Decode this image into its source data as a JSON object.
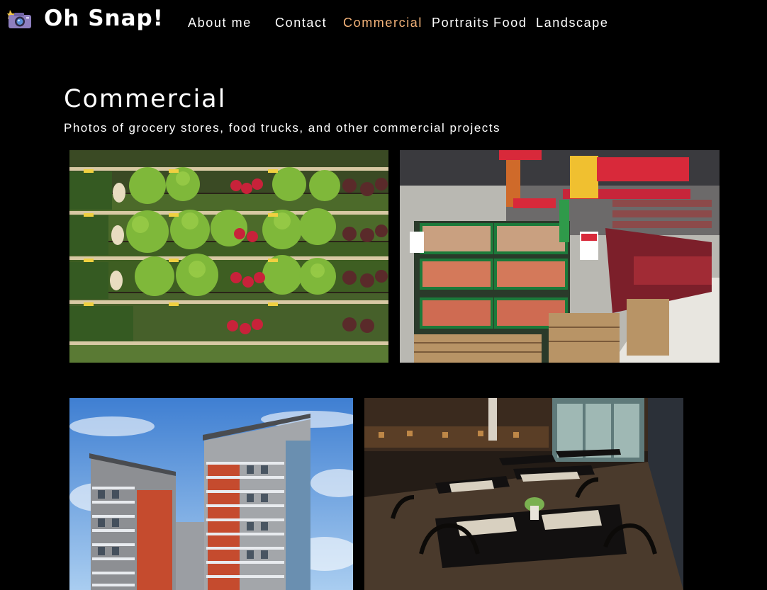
{
  "site": {
    "name": "Oh Snap!",
    "logo_icon": "camera-icon"
  },
  "nav": {
    "items": [
      {
        "label": "About me",
        "active": false
      },
      {
        "label": "Contact",
        "active": false
      },
      {
        "label": "Commercial",
        "active": true
      },
      {
        "label": "Portraits",
        "active": false
      },
      {
        "label": "Food",
        "active": false
      },
      {
        "label": "Landscape",
        "active": false
      }
    ],
    "active_color": "#f5b47a"
  },
  "page": {
    "title": "Commercial",
    "subtitle": "Photos of grocery stores, food trucks, and other commercial projects"
  },
  "gallery": {
    "photos": [
      {
        "subject": "produce-shelves"
      },
      {
        "subject": "supermarket-aisle"
      },
      {
        "subject": "apartment-building"
      },
      {
        "subject": "restaurant-interior"
      }
    ]
  }
}
